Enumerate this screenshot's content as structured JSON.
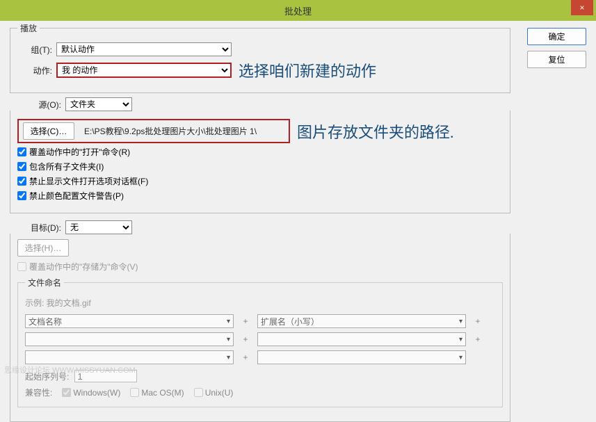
{
  "window": {
    "title": "批处理",
    "close": "×"
  },
  "buttons": {
    "ok": "确定",
    "reset": "复位"
  },
  "play": {
    "legend": "播放",
    "groupLabel": "组(T):",
    "groupValue": "默认动作",
    "actionLabel": "动作:",
    "actionValue": "我 的动作",
    "annotation": "选择咱们新建的动作"
  },
  "source": {
    "label": "源(O):",
    "value": "文件夹",
    "chooseBtn": "选择(C)…",
    "path": "E:\\PS教程\\9.2ps批处理图片大小\\批处理图片 1\\",
    "annotation": "图片存放文件夹的路径.",
    "opt1": "覆盖动作中的\"打开\"命令(R)",
    "opt2": "包含所有子文件夹(I)",
    "opt3": "禁止显示文件打开选项对话框(F)",
    "opt4": "禁止颜色配置文件警告(P)"
  },
  "dest": {
    "label": "目标(D):",
    "value": "无",
    "chooseBtn": "选择(H)…",
    "overrideSave": "覆盖动作中的\"存储为\"命令(V)"
  },
  "naming": {
    "legend": "文件命名",
    "example": "示例: 我的文档.gif",
    "field1": "文档名称",
    "field2": "扩展名（小写）",
    "serialLabel": "起始序列号:",
    "serialValue": "1",
    "compatLabel": "兼容性:",
    "win": "Windows(W)",
    "mac": "Mac OS(M)",
    "unix": "Unix(U)"
  },
  "watermark": "思缘设计论坛 WWW.MISSYUAN.COM"
}
